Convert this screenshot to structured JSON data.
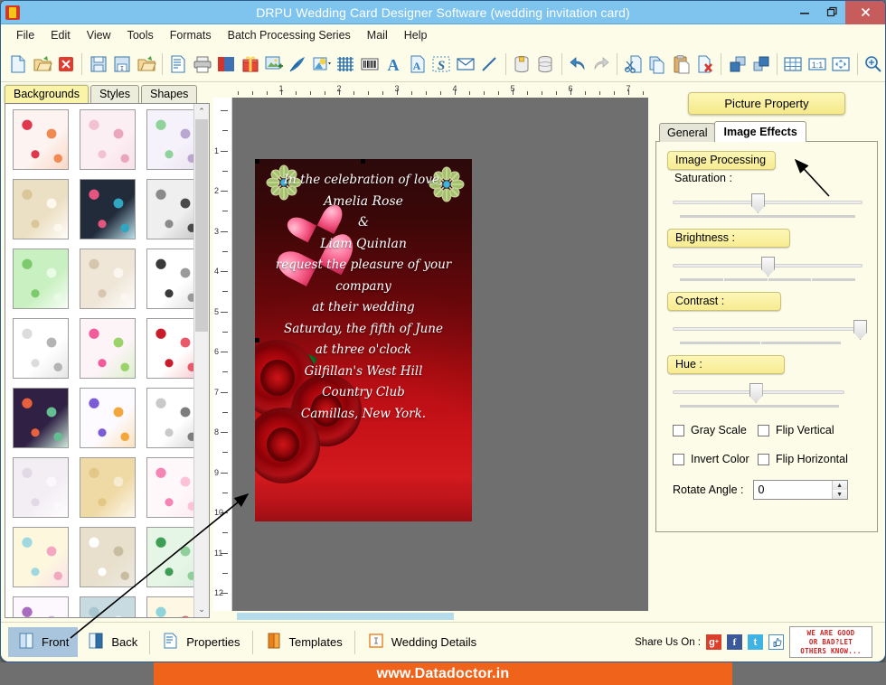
{
  "window": {
    "title": "DRPU Wedding Card Designer Software (wedding invitation card)",
    "minimize": "–",
    "restore": "❐",
    "close": "✕"
  },
  "menu": {
    "items": [
      "File",
      "Edit",
      "View",
      "Tools",
      "Formats",
      "Batch Processing Series",
      "Mail",
      "Help"
    ]
  },
  "toolbar": {
    "groups": [
      [
        "new-document-icon",
        "open-folder-icon",
        "close-document-icon"
      ],
      [
        "save-icon",
        "save-as-icon",
        "open-project-icon"
      ],
      [
        "page-setup-icon",
        "print-icon",
        "card-layers-icon",
        "gift-icon",
        "insert-image-icon",
        "pen-icon",
        "shape-fill-icon",
        "watermark-icon",
        "barcode-icon",
        "text-icon",
        "text-box-icon",
        "signature-icon",
        "envelope-icon",
        "line-icon"
      ],
      [
        "database-icon",
        "database-stack-icon"
      ],
      [
        "undo-icon",
        "redo-icon"
      ],
      [
        "cut-icon",
        "copy-icon",
        "paste-icon",
        "delete-icon"
      ],
      [
        "bring-to-front-icon",
        "send-to-back-icon"
      ],
      [
        "grid-icon",
        "actual-size-icon",
        "fit-to-window-icon"
      ],
      [
        "zoom-icon"
      ]
    ]
  },
  "left_panel": {
    "tabs": [
      {
        "label": "Backgrounds",
        "active": true
      },
      {
        "label": "Styles",
        "active": false
      },
      {
        "label": "Shapes",
        "active": false
      }
    ],
    "thumbnails": [
      {
        "name": "hearts-collage",
        "colors": [
          "#fdf3f0",
          "#e0374e",
          "#f08a52"
        ]
      },
      {
        "name": "pink-floral-soft",
        "colors": [
          "#fceff3",
          "#f2c2d2",
          "#e9a6bd"
        ]
      },
      {
        "name": "green-mandala",
        "colors": [
          "#f6f2fb",
          "#8fd29a",
          "#b9a7cf"
        ]
      },
      {
        "name": "cream-rose-ring",
        "colors": [
          "#ece0c4",
          "#d9c79a",
          "#fdf8ee"
        ]
      },
      {
        "name": "navy-floral-border",
        "colors": [
          "#222b3a",
          "#e5557f",
          "#2fa6c2"
        ]
      },
      {
        "name": "grey-lace",
        "colors": [
          "#efefef",
          "#8a8a8a",
          "#4a4a4a"
        ]
      },
      {
        "name": "green-swirl-frame",
        "colors": [
          "#c8f0c0",
          "#7dc96e",
          "#e8fbe4"
        ]
      },
      {
        "name": "beige-marble",
        "colors": [
          "#efe6d8",
          "#d6c6ae",
          "#fbf7f0"
        ]
      },
      {
        "name": "bw-stripe-lace",
        "colors": [
          "#ffffff",
          "#3a3a3a",
          "#9a9a9a"
        ]
      },
      {
        "name": "white-doves-outline",
        "colors": [
          "#ffffff",
          "#dcdcdc",
          "#b4b4b4"
        ]
      },
      {
        "name": "pink-butterfly-floral",
        "colors": [
          "#fdf4f8",
          "#f25c9b",
          "#9ad36a"
        ]
      },
      {
        "name": "red-ek-onkar",
        "colors": [
          "#ffffff",
          "#c81c2c",
          "#e8596a"
        ]
      },
      {
        "name": "paisley-multicolor",
        "colors": [
          "#2f2044",
          "#e8603c",
          "#63bf8f"
        ]
      },
      {
        "name": "confetti-floral",
        "colors": [
          "#fdfbff",
          "#7b5bd6",
          "#f2a63c"
        ]
      },
      {
        "name": "sketch-couple",
        "colors": [
          "#ffffff",
          "#c9c9c9",
          "#7d7d7d"
        ]
      },
      {
        "name": "white-satin-texture",
        "colors": [
          "#f3eef4",
          "#e2d9e6",
          "#fbf8fc"
        ]
      },
      {
        "name": "gold-damask-texture",
        "colors": [
          "#efd9a5",
          "#e2c787",
          "#f8ecd0"
        ]
      },
      {
        "name": "pink-blossom",
        "colors": [
          "#fff8fb",
          "#f585b4",
          "#fbc2d8"
        ]
      },
      {
        "name": "pastel-snowflake",
        "colors": [
          "#fdf8dd",
          "#9fd8e0",
          "#f4a7c1"
        ]
      },
      {
        "name": "beige-white-flowers",
        "colors": [
          "#e8e0cc",
          "#ffffff",
          "#c8bda0"
        ]
      },
      {
        "name": "green-paisley-swirl",
        "colors": [
          "#e6f6e6",
          "#3f9e56",
          "#8fcf9b"
        ]
      },
      {
        "name": "purple-dahlia",
        "colors": [
          "#fdf8fd",
          "#a96bc0",
          "#d8b6e2"
        ]
      },
      {
        "name": "blue-heart-drape",
        "colors": [
          "#c7dbe0",
          "#a8c7cf",
          "#e8f2f4"
        ]
      },
      {
        "name": "heart-border-stripes",
        "colors": [
          "#fdf7e4",
          "#8fd4d8",
          "#e8626f"
        ]
      }
    ],
    "scrollbar": {
      "up": "⌃",
      "down": "⌄"
    }
  },
  "canvas": {
    "h_ruler_numbers": [
      "1",
      "2",
      "3",
      "4",
      "5",
      "6",
      "7"
    ],
    "v_ruler_numbers": [
      "1",
      "2",
      "3",
      "4",
      "5",
      "6",
      "7",
      "8",
      "9",
      "10",
      "11",
      "12"
    ],
    "card": {
      "lines": [
        {
          "text": "In the celebration of love,",
          "style": "normal"
        },
        {
          "text": "Amelia Rose",
          "style": "name"
        },
        {
          "text": "&",
          "style": "normal"
        },
        {
          "text": "Liam Quinlan",
          "style": "name"
        },
        {
          "text": "request the pleasure of your",
          "style": "normal"
        },
        {
          "text": "company",
          "style": "normal"
        },
        {
          "text": "at their wedding",
          "style": "normal"
        },
        {
          "text": "Saturday, the fifth of June",
          "style": "normal"
        },
        {
          "text": "at three o'clock",
          "style": "normal"
        },
        {
          "text": "Gilfillan's West Hill",
          "style": "normal"
        },
        {
          "text": "Country Club",
          "style": "normal"
        },
        {
          "text": "Camillas, New York.",
          "style": "normal"
        }
      ],
      "background_color": "#b00d12"
    }
  },
  "right_panel": {
    "title": "Picture Property",
    "tabs": [
      {
        "label": "General",
        "active": false
      },
      {
        "label": "Image Effects",
        "active": true
      }
    ],
    "group_label": "Image Processing",
    "sliders": [
      {
        "label": "Saturation :",
        "style": "plain",
        "value_percent": 45,
        "tick_segments": 1
      },
      {
        "label": "Brightness :",
        "style": "yellow",
        "value_percent": 50,
        "tick_segments": 4
      },
      {
        "label": "Contrast :",
        "style": "yellow",
        "value_percent": 96,
        "tick_segments": 2
      },
      {
        "label": "Hue :",
        "style": "yellow",
        "value_percent": 44,
        "tick_segments": 1
      }
    ],
    "checkboxes": [
      {
        "label": "Gray Scale",
        "checked": false
      },
      {
        "label": "Flip Vertical",
        "checked": false
      },
      {
        "label": "Invert Color",
        "checked": false
      },
      {
        "label": "Flip Horizontal",
        "checked": false
      }
    ],
    "rotate": {
      "label": "Rotate Angle :",
      "value": "0",
      "up": "▲",
      "down": "▼"
    }
  },
  "bottom_bar": {
    "items": [
      {
        "label": "Front",
        "icon": "front-card-icon",
        "active": true
      },
      {
        "label": "Back",
        "icon": "back-card-icon",
        "active": false
      },
      {
        "label": "Properties",
        "icon": "properties-icon",
        "active": false
      },
      {
        "label": "Templates",
        "icon": "templates-icon",
        "active": false
      },
      {
        "label": "Wedding Details",
        "icon": "wedding-details-icon",
        "active": false
      }
    ],
    "share_label": "Share Us On :",
    "share_icons": [
      {
        "name": "google-plus-icon",
        "glyph": "g+",
        "color": "#d93f2b"
      },
      {
        "name": "facebook-icon",
        "glyph": "f",
        "color": "#3b5998"
      },
      {
        "name": "twitter-icon",
        "glyph": "t",
        "color": "#3fb3e3"
      },
      {
        "name": "thumbs-up-icon",
        "glyph": "△",
        "color": "#ffffff"
      }
    ],
    "review_badge": {
      "line1": "WE ARE GOOD",
      "line2": "OR BAD?LET",
      "line3": "OTHERS KNOW..."
    }
  },
  "footer": {
    "url": "www.Datadoctor.in"
  }
}
